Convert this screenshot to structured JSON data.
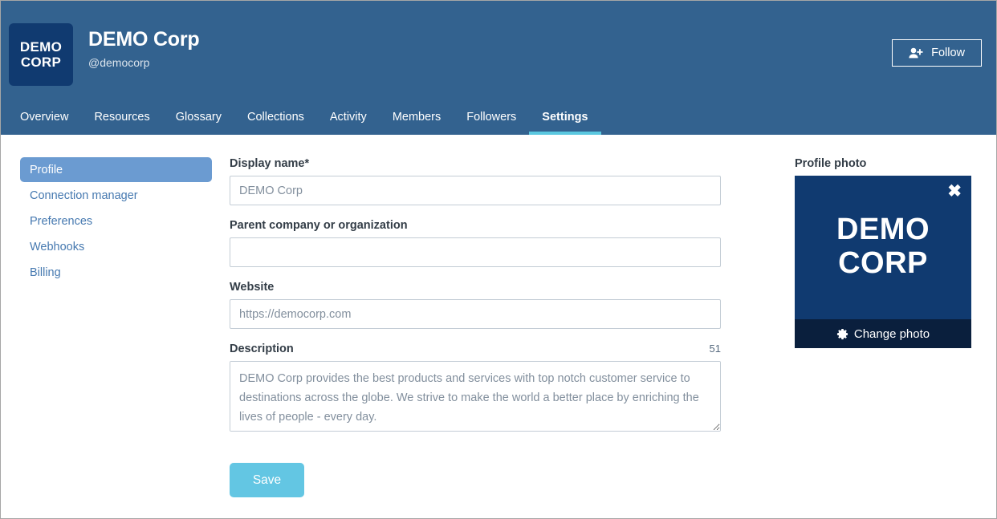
{
  "header": {
    "logo_line1": "DEMO",
    "logo_line2": "CORP",
    "title": "DEMO Corp",
    "handle": "@democorp",
    "follow_label": "Follow",
    "follow_icon": "user-plus-icon",
    "background_color": "#33628f",
    "logo_color": "#103a70",
    "active_tab_underline_color": "#5bc8e0"
  },
  "tabs": [
    {
      "label": "Overview",
      "active": false
    },
    {
      "label": "Resources",
      "active": false
    },
    {
      "label": "Glossary",
      "active": false
    },
    {
      "label": "Collections",
      "active": false
    },
    {
      "label": "Activity",
      "active": false
    },
    {
      "label": "Members",
      "active": false
    },
    {
      "label": "Followers",
      "active": false
    },
    {
      "label": "Settings",
      "active": true
    }
  ],
  "sidebar": {
    "items": [
      {
        "label": "Profile",
        "active": true
      },
      {
        "label": "Connection manager",
        "active": false
      },
      {
        "label": "Preferences",
        "active": false
      },
      {
        "label": "Webhooks",
        "active": false
      },
      {
        "label": "Billing",
        "active": false
      }
    ],
    "active_color": "#6b9bd1",
    "link_color": "#4679b0"
  },
  "form": {
    "display_name": {
      "label": "Display name*",
      "value": "DEMO Corp",
      "placeholder": "DEMO Corp"
    },
    "parent_company": {
      "label": "Parent company or organization",
      "value": "",
      "placeholder": ""
    },
    "website": {
      "label": "Website",
      "value": "https://democorp.com",
      "placeholder": "https://democorp.com"
    },
    "description": {
      "label": "Description",
      "counter": "51",
      "value": "DEMO Corp provides the best products and services with top notch customer service to destinations across the globe. We strive to make the world a better place by enriching the lives of people - every day.",
      "placeholder": ""
    },
    "save_label": "Save",
    "save_color": "#63c6e3"
  },
  "photo": {
    "label": "Profile photo",
    "logo_line1": "DEMO",
    "logo_line2": "CORP",
    "close_icon": "close-icon",
    "close_glyph": "✖",
    "change_label": "Change photo",
    "change_icon": "gear-icon",
    "card_color": "#103a70",
    "action_bar_color": "#0a1f3d"
  }
}
